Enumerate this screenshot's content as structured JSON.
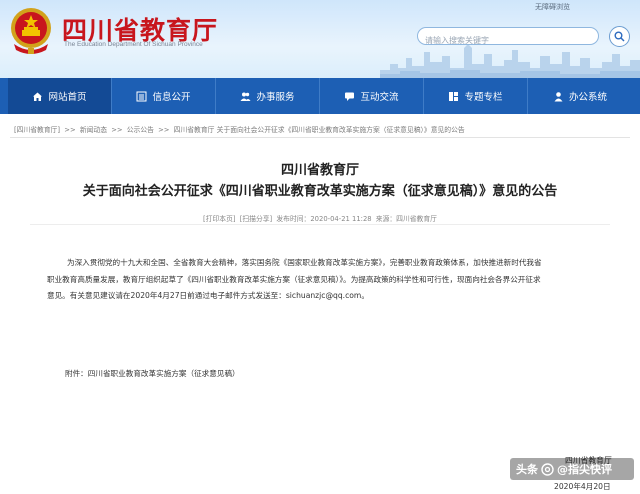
{
  "header": {
    "site_title": "四川省教育厅",
    "site_subtitle": "The Education Department Of Sichuan Province",
    "top_link": "无障碍浏览",
    "search_placeholder": "请输入搜索关键字"
  },
  "nav": {
    "items": [
      {
        "label": "网站首页",
        "icon": "home-icon"
      },
      {
        "label": "信息公开",
        "icon": "list-icon"
      },
      {
        "label": "办事服务",
        "icon": "people-icon"
      },
      {
        "label": "互动交流",
        "icon": "chat-icon"
      },
      {
        "label": "专题专栏",
        "icon": "columns-icon"
      },
      {
        "label": "办公系统",
        "icon": "person-icon"
      }
    ]
  },
  "breadcrumb": [
    "[四川省教育厅]",
    ">>",
    "新闻动态",
    ">>",
    "公示公告",
    ">>",
    "四川省教育厅 关于面向社会公开征求《四川省职业教育改革实施方案（征求意见稿）》意见的公告"
  ],
  "article": {
    "title_line1": "四川省教育厅",
    "title_line2": "关于面向社会公开征求《四川省职业教育改革实施方案（征求意见稿）》意见的公告",
    "meta": {
      "print": "[打印本页]",
      "share": "[扫描分享]",
      "published": "发布时间：2020-04-21 11:28",
      "source": "来源：四川省教育厅"
    },
    "body_line1": "为深入贯彻党的十九大和全国、全省教育大会精神，落实国务院《国家职业教育改革实施方案》，完善职业教育政策体系，加快推进新时代我省",
    "body_line2": "职业教育高质量发展，教育厅组织起草了《四川省职业教育改革实施方案（征求意见稿）》。为提高政策的科学性和可行性，现面向社会各界公开征求",
    "body_line3": "意见。有关意见建议请在2020年4月27日前通过电子邮件方式发送至：sichuanzjc@qq.com。",
    "attachment": "附件：四川省职业教育改革实施方案（征求意见稿）",
    "sign_org": "四川省教育厅",
    "sign_date": "2020年4月20日"
  },
  "watermark": {
    "prefix": "头条",
    "account": "@指尖快评"
  },
  "colors": {
    "nav_bg": "#1d5fb4",
    "nav_active": "#134a95",
    "title_red": "#c8161d"
  }
}
